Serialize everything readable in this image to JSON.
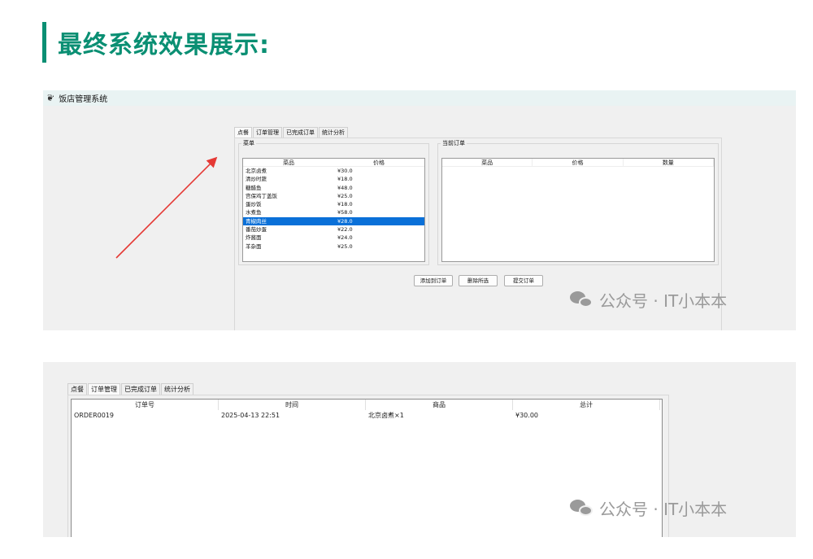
{
  "heading": {
    "title": "最终系统效果展示:"
  },
  "window": {
    "title": "饭店管理系统",
    "icon": "feather-icon"
  },
  "tabs": [
    "点餐",
    "订单管理",
    "已完成订单",
    "统计分析"
  ],
  "ordering": {
    "menu_group_label": "菜单",
    "menu_columns": [
      "菜品",
      "价格"
    ],
    "menu_items": [
      {
        "name": "北京卤煮",
        "price": "¥30.0"
      },
      {
        "name": "清炒时蔬",
        "price": "¥18.0"
      },
      {
        "name": "糖醋鱼",
        "price": "¥48.0"
      },
      {
        "name": "宫保鸡丁盖饭",
        "price": "¥25.0"
      },
      {
        "name": "蛋炒饭",
        "price": "¥18.0"
      },
      {
        "name": "水煮鱼",
        "price": "¥58.0"
      },
      {
        "name": "青椒肉丝",
        "price": "¥28.0"
      },
      {
        "name": "番茄炒蛋",
        "price": "¥22.0"
      },
      {
        "name": "炸酱面",
        "price": "¥24.0"
      },
      {
        "name": "羊杂面",
        "price": "¥25.0"
      }
    ],
    "selected_index": 6,
    "current_group_label": "当前订单",
    "current_columns": [
      "菜品",
      "价格",
      "数量"
    ],
    "buttons": {
      "add": "添加到订单",
      "delete": "删除所选",
      "submit": "提交订单"
    }
  },
  "orders": {
    "columns": [
      "订单号",
      "时间",
      "商品",
      "总计"
    ],
    "rows": [
      {
        "id": "ORDER0019",
        "time": "2025-04-13 22:51",
        "items": "北京卤煮×1",
        "total": "¥30.00"
      }
    ]
  },
  "watermark": {
    "text": "公众号 · IT小本本",
    "icon": "wechat-icon"
  },
  "colors": {
    "accent": "#0a8f73",
    "selection": "#0a70d8",
    "arrow": "#e53935"
  }
}
